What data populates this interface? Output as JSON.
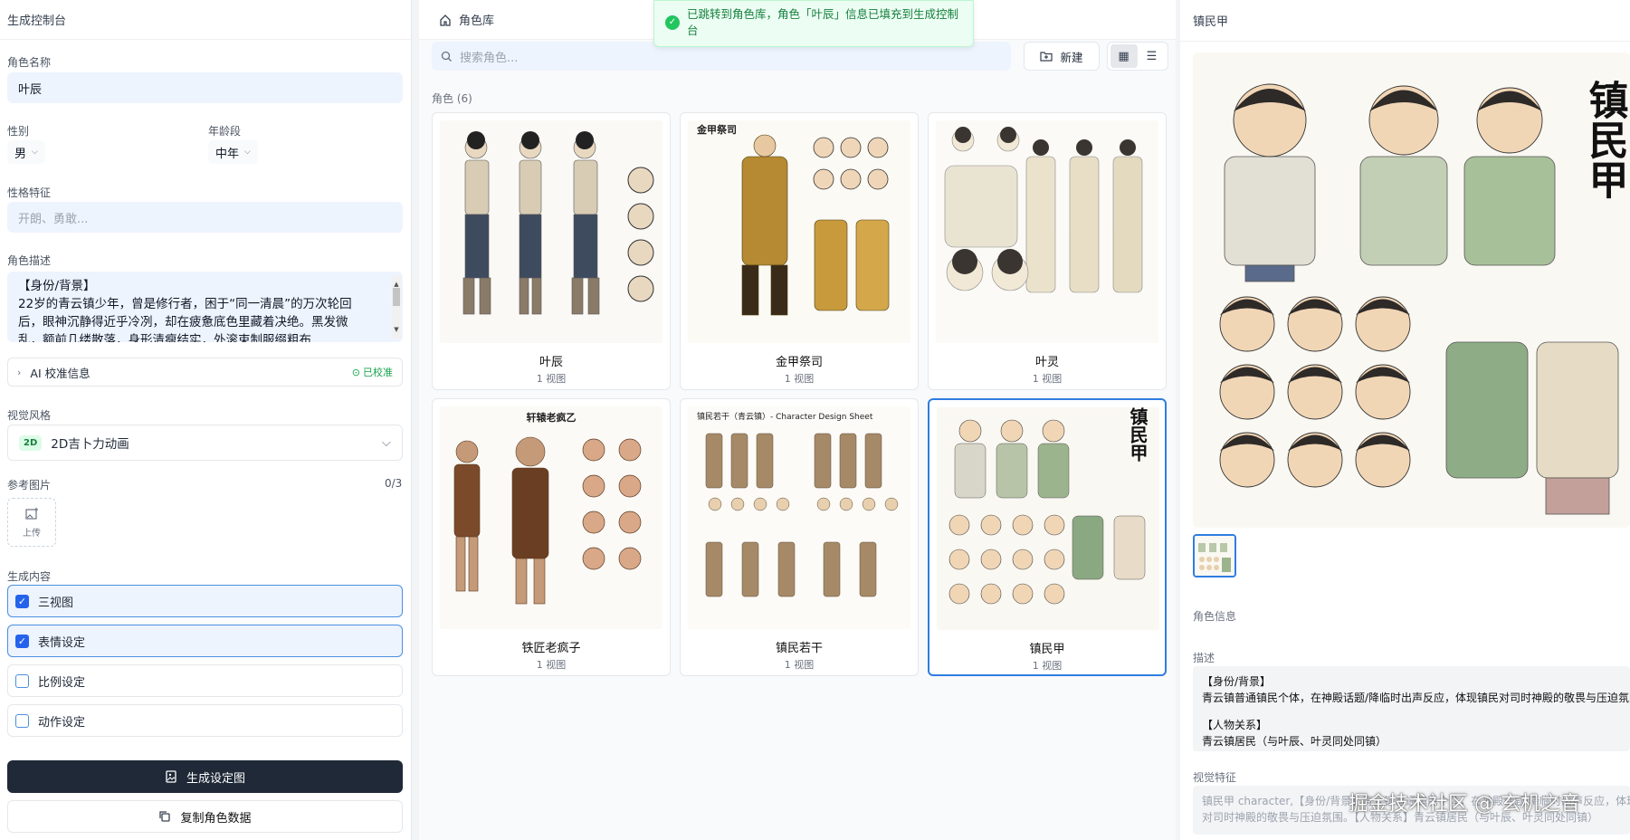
{
  "left": {
    "title": "生成控制台",
    "name_label": "角色名称",
    "name_value": "叶辰",
    "gender_label": "性别",
    "gender_value": "男",
    "age_label": "年龄段",
    "age_value": "中年",
    "personality_label": "性格特征",
    "personality_placeholder": "开朗、勇敢...",
    "desc_label": "角色描述",
    "desc_line1": "【身份/背景】",
    "desc_line2": "22岁的青云镇少年，曾是修行者，困于“同一清晨”的万次轮回",
    "desc_line3": "后，眼神沉静得近乎冷冽，却在疲惫底色里藏着决绝。黑发微",
    "desc_line4": "乱，额前几缕散落，身形清瘦结实，外滚束制服缀粗布",
    "ai_info_label": "AI 校准信息",
    "ai_info_status": "已校准",
    "style_label": "视觉风格",
    "style_tag": "2D",
    "style_value": "2D吉卜力动画",
    "ref_label": "参考图片",
    "ref_count": "0/3",
    "upload_label": "上传",
    "gen_label": "生成内容",
    "options": [
      {
        "label": "三视图",
        "checked": true
      },
      {
        "label": "表情设定",
        "checked": true
      },
      {
        "label": "比例设定",
        "checked": false
      },
      {
        "label": "动作设定",
        "checked": false
      }
    ],
    "generate_btn": "生成设定图",
    "copy_btn": "复制角色数据"
  },
  "mid": {
    "title": "角色库",
    "search_placeholder": "搜索角色...",
    "new_btn": "新建",
    "count_label": "角色 (6)",
    "cards": [
      {
        "name": "叶辰",
        "views": "1 视图"
      },
      {
        "name": "金甲祭司",
        "views": "1 视图",
        "header": "金甲祭司"
      },
      {
        "name": "叶灵",
        "views": "1 视图"
      },
      {
        "name": "铁匠老疯子",
        "views": "1 视图",
        "header": "轩辕老疯乙"
      },
      {
        "name": "镇民若干",
        "views": "1 视图",
        "header": "镇民若干（青云镇）- Character Design Sheet"
      },
      {
        "name": "镇民甲",
        "views": "1 视图",
        "header": "镇民甲"
      }
    ]
  },
  "toast": {
    "text": "已跳转到角色库，角色「叶辰」信息已填充到生成控制台"
  },
  "right": {
    "title": "镇民甲",
    "image_text": "镇民甲",
    "info_label": "角色信息",
    "desc_label": "描述",
    "desc_line1": "【身份/背景】",
    "desc_line2": "青云镇普通镇民个体，在神殿话题/降临时出声反应，体现镇民对司时神殿的敬畏与压迫氛围",
    "desc_line3": "【人物关系】",
    "desc_line4": "青云镇居民（与叶辰、叶灵同处同镇）",
    "visual_label": "视觉特征",
    "visual_line1": "镇民甲 character,【身份/背景】青云镇普通镇民个体，在神殿话题/降临时出声反应，体现镇民",
    "visual_line2": "对司时神殿的敬畏与压迫氛围。【人物关系】青云镇居民（与叶辰、叶灵同处同镇）"
  },
  "watermark": "掘金技术社区 @ 玄机之音",
  "colors": {
    "accent": "#2563eb",
    "success": "#16a34a",
    "dark_button": "#1f2937"
  }
}
